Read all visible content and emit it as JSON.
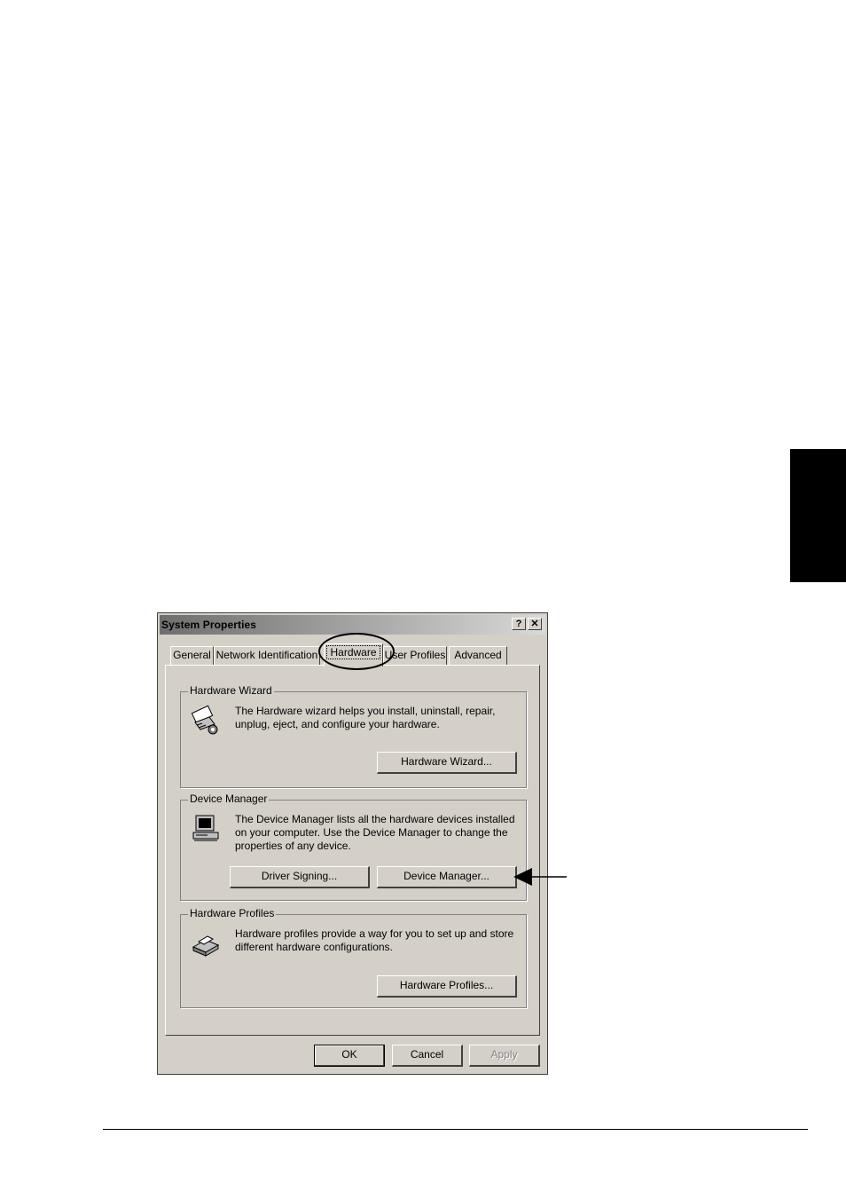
{
  "dialog": {
    "title": "System Properties",
    "help_button": "?",
    "close_button": "✕",
    "tabs": [
      {
        "label": "General"
      },
      {
        "label": "Network Identification"
      },
      {
        "label": "Hardware",
        "active": true
      },
      {
        "label": "User Profiles"
      },
      {
        "label": "Advanced"
      }
    ],
    "hardware_wizard": {
      "title": "Hardware Wizard",
      "description": "The Hardware wizard helps you install, uninstall, repair, unplug, eject, and configure your hardware.",
      "button": "Hardware Wizard..."
    },
    "device_manager": {
      "title": "Device Manager",
      "description": "The Device Manager lists all the hardware devices installed on your computer. Use the Device Manager to change the properties of any device.",
      "driver_signing_button": "Driver Signing...",
      "device_manager_button": "Device Manager..."
    },
    "hardware_profiles": {
      "title": "Hardware Profiles",
      "description": "Hardware profiles provide a way for you to set up and store different hardware configurations.",
      "button": "Hardware Profiles..."
    },
    "ok_button": "OK",
    "cancel_button": "Cancel",
    "apply_button": "Apply"
  }
}
